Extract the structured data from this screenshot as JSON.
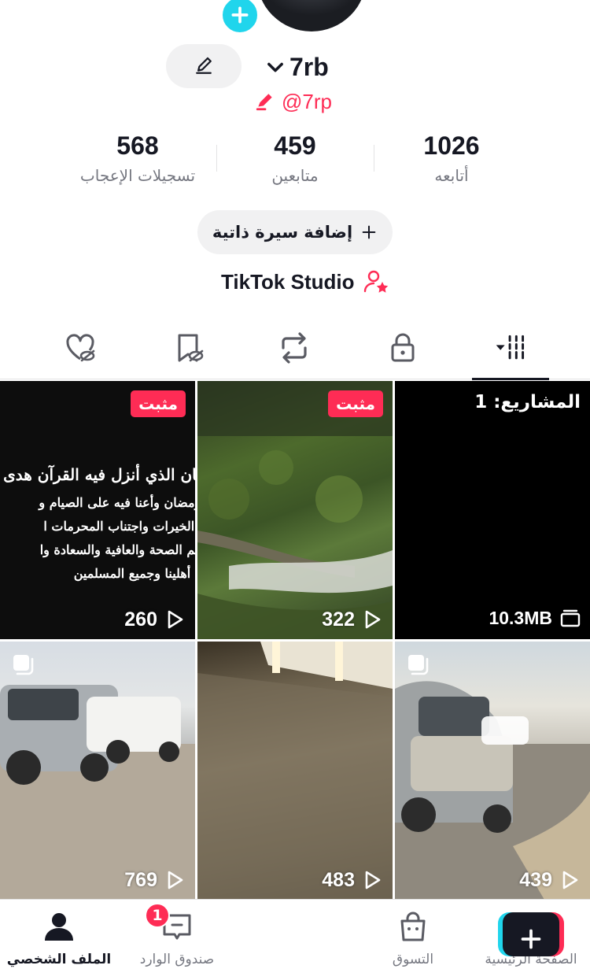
{
  "profile": {
    "display_name": "7rb",
    "username": "@7rp"
  },
  "stats": {
    "likes": {
      "value": "568",
      "label": "تسجيلات الإعجاب"
    },
    "followers": {
      "value": "459",
      "label": "متابعين"
    },
    "following": {
      "value": "1026",
      "label": "أتابعه"
    }
  },
  "actions": {
    "add_bio_label": "إضافة سيرة ذاتية",
    "studio_label": "TikTok Studio"
  },
  "tabs": [
    {
      "name": "videos",
      "icon": "grid-columns-icon",
      "active": true
    },
    {
      "name": "private",
      "icon": "lock-icon",
      "active": false
    },
    {
      "name": "reposts",
      "icon": "repost-icon",
      "active": false
    },
    {
      "name": "favorites",
      "icon": "bookmark-icon",
      "active": false
    },
    {
      "name": "liked",
      "icon": "heart-hidden-icon",
      "active": false
    }
  ],
  "grid": {
    "drafts": {
      "projects_label": "المشاريع: 1",
      "size": "10.3MB"
    },
    "items": [
      {
        "views": "322",
        "pinned_label": "مثبت"
      },
      {
        "views": "260",
        "pinned_label": "مثبت"
      },
      {
        "views": "439"
      },
      {
        "views": "483"
      },
      {
        "views": "769"
      }
    ],
    "quran_text": {
      "verse": "رمضان الذي أنزل فيه القرآن هدى",
      "line1": "بلغنا رمضان وأعنا فيه على الصيام و",
      "line2": "وفعل الخيرات واجتناب المحرمات ا",
      "line3": "ربي أتم الصحة والعافية والسعادة وا",
      "line4": "وجميع أهلينا وجميع المسلمين"
    }
  },
  "bottom_nav": {
    "home": "الصفحة الرئيسية",
    "shop": "التسوق",
    "inbox": "صندوق الوارد",
    "inbox_badge": "1",
    "profile": "الملف الشخصي"
  },
  "colors": {
    "accent_red": "#fe2c55",
    "accent_cyan": "#20d5ec",
    "text_primary": "#161823",
    "text_secondary": "#757780"
  }
}
